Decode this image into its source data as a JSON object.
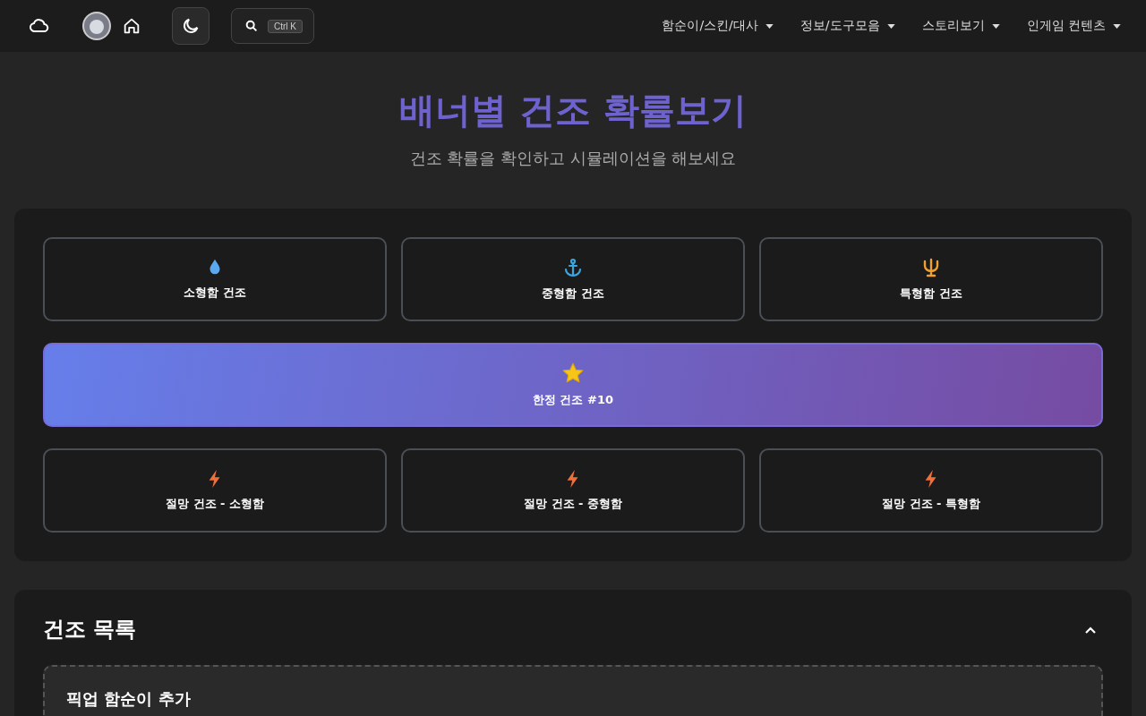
{
  "header": {
    "search_shortcut": "Ctrl K",
    "menus": [
      {
        "label": "함순이/스킨/대사"
      },
      {
        "label": "정보/도구모음"
      },
      {
        "label": "스토리보기"
      },
      {
        "label": "인게임 컨텐츠"
      }
    ]
  },
  "hero": {
    "title": "배너별 건조 확률보기",
    "subtitle": "건조 확률을 확인하고 시뮬레이션을 해보세요"
  },
  "banner_rows": [
    [
      {
        "label": "소형함 건조",
        "kind": "drop",
        "selected": false
      },
      {
        "label": "중형함 건조",
        "kind": "anchor",
        "selected": false
      },
      {
        "label": "특형함 건조",
        "kind": "trident",
        "selected": false
      }
    ],
    [
      {
        "label": "한정 건조 #10",
        "kind": "star",
        "selected": true
      }
    ],
    [
      {
        "label": "절망 건조 - 소형함",
        "kind": "bolt",
        "selected": false
      },
      {
        "label": "절망 건조 - 중형함",
        "kind": "bolt",
        "selected": false
      },
      {
        "label": "절망 건조 - 특형함",
        "kind": "bolt",
        "selected": false
      }
    ]
  ],
  "build_list": {
    "title": "건조 목록",
    "expanded": true,
    "add_title": "픽업 함순이 추가"
  }
}
